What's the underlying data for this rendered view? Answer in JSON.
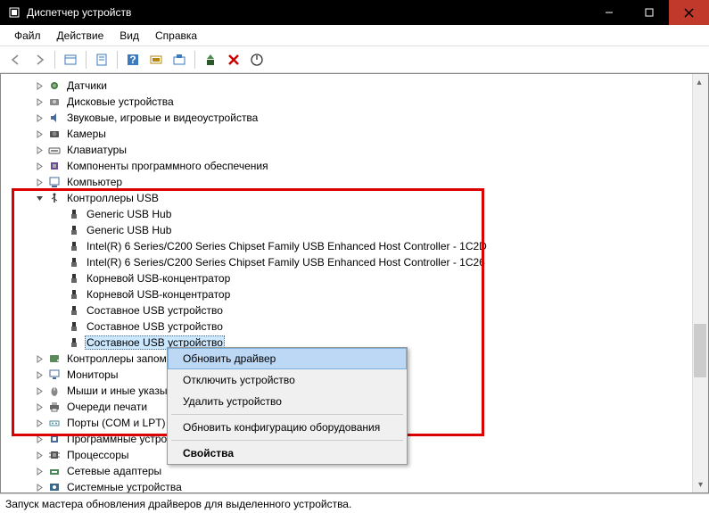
{
  "title": "Диспетчер устройств",
  "menu": [
    "Файл",
    "Действие",
    "Вид",
    "Справка"
  ],
  "tree": {
    "items": [
      {
        "lvl": 1,
        "exp": "c",
        "icon": "sensor",
        "label": "Датчики"
      },
      {
        "lvl": 1,
        "exp": "c",
        "icon": "disk",
        "label": "Дисковые устройства"
      },
      {
        "lvl": 1,
        "exp": "c",
        "icon": "audio",
        "label": "Звуковые, игровые и видеоустройства"
      },
      {
        "lvl": 1,
        "exp": "c",
        "icon": "camera",
        "label": "Камеры"
      },
      {
        "lvl": 1,
        "exp": "c",
        "icon": "keyboard",
        "label": "Клавиатуры"
      },
      {
        "lvl": 1,
        "exp": "c",
        "icon": "component",
        "label": "Компоненты программного обеспечения"
      },
      {
        "lvl": 1,
        "exp": "c",
        "icon": "computer",
        "label": "Компьютер"
      },
      {
        "lvl": 1,
        "exp": "o",
        "icon": "usb",
        "label": "Контроллеры USB"
      },
      {
        "lvl": 2,
        "exp": "",
        "icon": "usbdev",
        "label": "Generic USB Hub"
      },
      {
        "lvl": 2,
        "exp": "",
        "icon": "usbdev",
        "label": "Generic USB Hub"
      },
      {
        "lvl": 2,
        "exp": "",
        "icon": "usbdev",
        "label": "Intel(R) 6 Series/C200 Series Chipset Family USB Enhanced Host Controller - 1C2D"
      },
      {
        "lvl": 2,
        "exp": "",
        "icon": "usbdev",
        "label": "Intel(R) 6 Series/C200 Series Chipset Family USB Enhanced Host Controller - 1C26"
      },
      {
        "lvl": 2,
        "exp": "",
        "icon": "usbdev",
        "label": "Корневой USB-концентратор"
      },
      {
        "lvl": 2,
        "exp": "",
        "icon": "usbdev",
        "label": "Корневой USB-концентратор"
      },
      {
        "lvl": 2,
        "exp": "",
        "icon": "usbdev",
        "label": "Составное USB устройство"
      },
      {
        "lvl": 2,
        "exp": "",
        "icon": "usbdev",
        "label": "Составное USB устройство"
      },
      {
        "lvl": 2,
        "exp": "",
        "icon": "usbdev",
        "label": "Составное USB устройство",
        "selected": true
      },
      {
        "lvl": 1,
        "exp": "c",
        "icon": "storage",
        "label": "Контроллеры запоминающих устройств"
      },
      {
        "lvl": 1,
        "exp": "c",
        "icon": "monitor",
        "label": "Мониторы"
      },
      {
        "lvl": 1,
        "exp": "c",
        "icon": "mouse",
        "label": "Мыши и иные указывающие устройства"
      },
      {
        "lvl": 1,
        "exp": "c",
        "icon": "printer",
        "label": "Очереди печати"
      },
      {
        "lvl": 1,
        "exp": "c",
        "icon": "port",
        "label": "Порты (COM и LPT)"
      },
      {
        "lvl": 1,
        "exp": "c",
        "icon": "software",
        "label": "Программные устройства"
      },
      {
        "lvl": 1,
        "exp": "c",
        "icon": "cpu",
        "label": "Процессоры"
      },
      {
        "lvl": 1,
        "exp": "c",
        "icon": "network",
        "label": "Сетевые адаптеры"
      },
      {
        "lvl": 1,
        "exp": "c",
        "icon": "system",
        "label": "Системные устройства"
      }
    ]
  },
  "ctxmenu": [
    {
      "label": "Обновить драйвер",
      "hl": true
    },
    {
      "label": "Отключить устройство"
    },
    {
      "label": "Удалить устройство"
    },
    {
      "sep": true
    },
    {
      "label": "Обновить конфигурацию оборудования"
    },
    {
      "sep": true
    },
    {
      "label": "Свойства",
      "bold": true
    }
  ],
  "statusbar": "Запуск мастера обновления драйверов для выделенного устройства."
}
